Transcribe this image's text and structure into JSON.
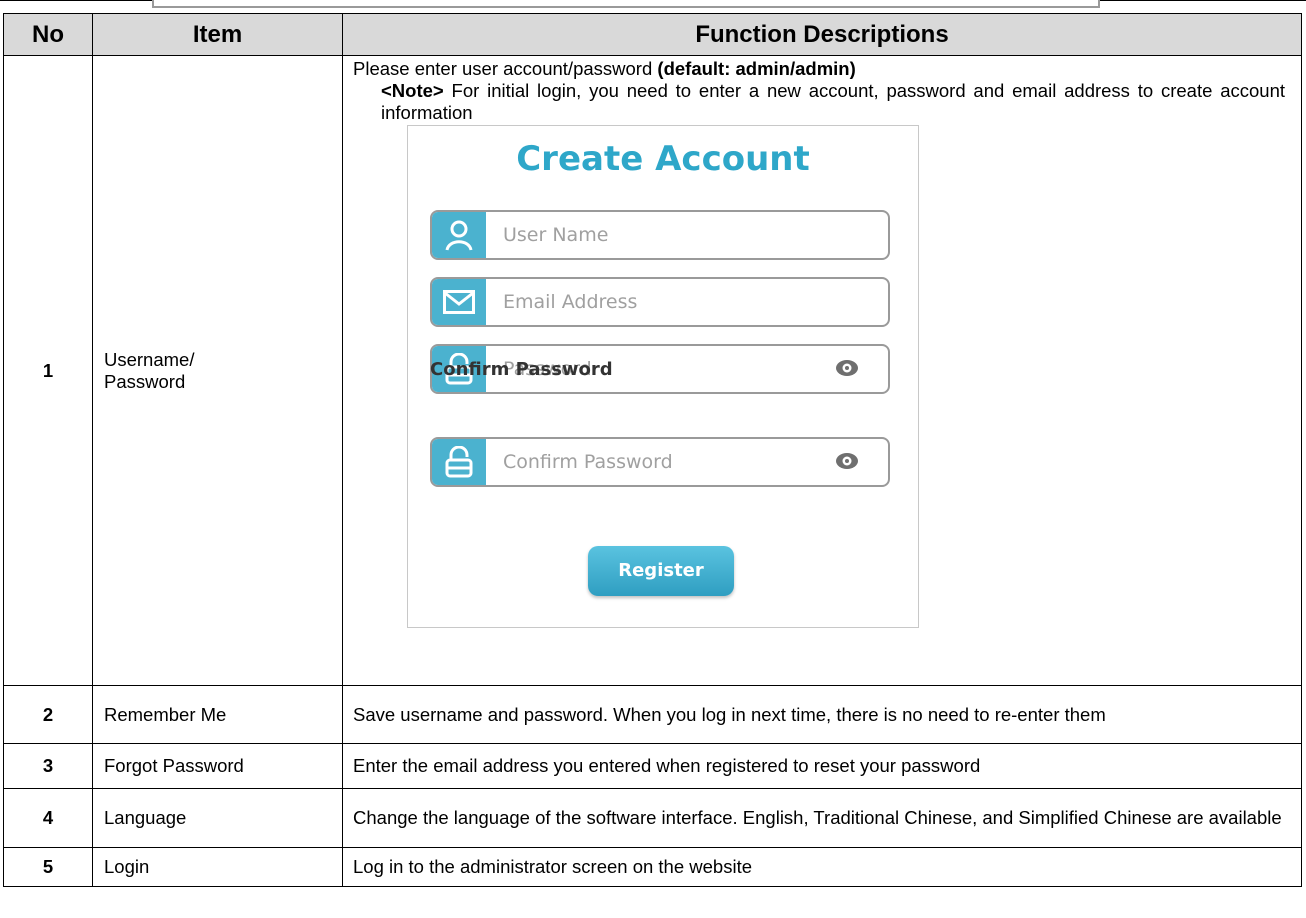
{
  "table": {
    "headers": {
      "no": "No",
      "item": "Item",
      "desc": "Function Descriptions"
    },
    "rows": [
      {
        "no": "1",
        "item": "Username/\nPassword",
        "desc_main": "Please enter user account/password ",
        "desc_main_bold": "(default: admin/admin)",
        "note_label": "<Note>",
        "note_text": " For initial login, you need to enter a new account, password and email address to create account information"
      },
      {
        "no": "2",
        "item": "Remember Me",
        "desc": "Save username and password. When you log in next time, there is no need to re-enter them"
      },
      {
        "no": "3",
        "item": "Forgot Password",
        "desc": "Enter the email address you entered when registered to reset your password"
      },
      {
        "no": "4",
        "item": "Language",
        "desc": "Change the language of the software interface. English, Traditional Chinese, and Simplified Chinese are available"
      },
      {
        "no": "5",
        "item": "Login",
        "desc": "Log in to the administrator screen on the website"
      }
    ]
  },
  "create_account": {
    "title": "Create Account",
    "username_placeholder": "User Name",
    "email_placeholder": "Email Address",
    "password_placeholder": "Password",
    "confirm_label": "Confirm Password",
    "confirm_placeholder": "Confirm Password",
    "register_label": "Register",
    "icons": {
      "username": "user-icon",
      "email": "envelope-icon",
      "password": "lock-icon",
      "confirm": "lock-icon",
      "show_password": "eye-icon"
    },
    "accent_color": "#2ea7c9",
    "icon_bg_color": "#4bb2cf"
  },
  "colors": {
    "header_bg": "#d9d9d9"
  }
}
